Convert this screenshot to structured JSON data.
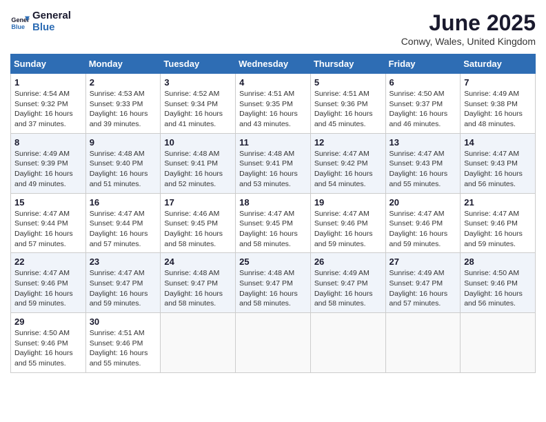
{
  "logo": {
    "line1": "General",
    "line2": "Blue"
  },
  "title": "June 2025",
  "location": "Conwy, Wales, United Kingdom",
  "days_of_week": [
    "Sunday",
    "Monday",
    "Tuesday",
    "Wednesday",
    "Thursday",
    "Friday",
    "Saturday"
  ],
  "weeks": [
    [
      {
        "day": "1",
        "sunrise": "Sunrise: 4:54 AM",
        "sunset": "Sunset: 9:32 PM",
        "daylight": "Daylight: 16 hours and 37 minutes."
      },
      {
        "day": "2",
        "sunrise": "Sunrise: 4:53 AM",
        "sunset": "Sunset: 9:33 PM",
        "daylight": "Daylight: 16 hours and 39 minutes."
      },
      {
        "day": "3",
        "sunrise": "Sunrise: 4:52 AM",
        "sunset": "Sunset: 9:34 PM",
        "daylight": "Daylight: 16 hours and 41 minutes."
      },
      {
        "day": "4",
        "sunrise": "Sunrise: 4:51 AM",
        "sunset": "Sunset: 9:35 PM",
        "daylight": "Daylight: 16 hours and 43 minutes."
      },
      {
        "day": "5",
        "sunrise": "Sunrise: 4:51 AM",
        "sunset": "Sunset: 9:36 PM",
        "daylight": "Daylight: 16 hours and 45 minutes."
      },
      {
        "day": "6",
        "sunrise": "Sunrise: 4:50 AM",
        "sunset": "Sunset: 9:37 PM",
        "daylight": "Daylight: 16 hours and 46 minutes."
      },
      {
        "day": "7",
        "sunrise": "Sunrise: 4:49 AM",
        "sunset": "Sunset: 9:38 PM",
        "daylight": "Daylight: 16 hours and 48 minutes."
      }
    ],
    [
      {
        "day": "8",
        "sunrise": "Sunrise: 4:49 AM",
        "sunset": "Sunset: 9:39 PM",
        "daylight": "Daylight: 16 hours and 49 minutes."
      },
      {
        "day": "9",
        "sunrise": "Sunrise: 4:48 AM",
        "sunset": "Sunset: 9:40 PM",
        "daylight": "Daylight: 16 hours and 51 minutes."
      },
      {
        "day": "10",
        "sunrise": "Sunrise: 4:48 AM",
        "sunset": "Sunset: 9:41 PM",
        "daylight": "Daylight: 16 hours and 52 minutes."
      },
      {
        "day": "11",
        "sunrise": "Sunrise: 4:48 AM",
        "sunset": "Sunset: 9:41 PM",
        "daylight": "Daylight: 16 hours and 53 minutes."
      },
      {
        "day": "12",
        "sunrise": "Sunrise: 4:47 AM",
        "sunset": "Sunset: 9:42 PM",
        "daylight": "Daylight: 16 hours and 54 minutes."
      },
      {
        "day": "13",
        "sunrise": "Sunrise: 4:47 AM",
        "sunset": "Sunset: 9:43 PM",
        "daylight": "Daylight: 16 hours and 55 minutes."
      },
      {
        "day": "14",
        "sunrise": "Sunrise: 4:47 AM",
        "sunset": "Sunset: 9:43 PM",
        "daylight": "Daylight: 16 hours and 56 minutes."
      }
    ],
    [
      {
        "day": "15",
        "sunrise": "Sunrise: 4:47 AM",
        "sunset": "Sunset: 9:44 PM",
        "daylight": "Daylight: 16 hours and 57 minutes."
      },
      {
        "day": "16",
        "sunrise": "Sunrise: 4:47 AM",
        "sunset": "Sunset: 9:44 PM",
        "daylight": "Daylight: 16 hours and 57 minutes."
      },
      {
        "day": "17",
        "sunrise": "Sunrise: 4:46 AM",
        "sunset": "Sunset: 9:45 PM",
        "daylight": "Daylight: 16 hours and 58 minutes."
      },
      {
        "day": "18",
        "sunrise": "Sunrise: 4:47 AM",
        "sunset": "Sunset: 9:45 PM",
        "daylight": "Daylight: 16 hours and 58 minutes."
      },
      {
        "day": "19",
        "sunrise": "Sunrise: 4:47 AM",
        "sunset": "Sunset: 9:46 PM",
        "daylight": "Daylight: 16 hours and 59 minutes."
      },
      {
        "day": "20",
        "sunrise": "Sunrise: 4:47 AM",
        "sunset": "Sunset: 9:46 PM",
        "daylight": "Daylight: 16 hours and 59 minutes."
      },
      {
        "day": "21",
        "sunrise": "Sunrise: 4:47 AM",
        "sunset": "Sunset: 9:46 PM",
        "daylight": "Daylight: 16 hours and 59 minutes."
      }
    ],
    [
      {
        "day": "22",
        "sunrise": "Sunrise: 4:47 AM",
        "sunset": "Sunset: 9:46 PM",
        "daylight": "Daylight: 16 hours and 59 minutes."
      },
      {
        "day": "23",
        "sunrise": "Sunrise: 4:47 AM",
        "sunset": "Sunset: 9:47 PM",
        "daylight": "Daylight: 16 hours and 59 minutes."
      },
      {
        "day": "24",
        "sunrise": "Sunrise: 4:48 AM",
        "sunset": "Sunset: 9:47 PM",
        "daylight": "Daylight: 16 hours and 58 minutes."
      },
      {
        "day": "25",
        "sunrise": "Sunrise: 4:48 AM",
        "sunset": "Sunset: 9:47 PM",
        "daylight": "Daylight: 16 hours and 58 minutes."
      },
      {
        "day": "26",
        "sunrise": "Sunrise: 4:49 AM",
        "sunset": "Sunset: 9:47 PM",
        "daylight": "Daylight: 16 hours and 58 minutes."
      },
      {
        "day": "27",
        "sunrise": "Sunrise: 4:49 AM",
        "sunset": "Sunset: 9:47 PM",
        "daylight": "Daylight: 16 hours and 57 minutes."
      },
      {
        "day": "28",
        "sunrise": "Sunrise: 4:50 AM",
        "sunset": "Sunset: 9:46 PM",
        "daylight": "Daylight: 16 hours and 56 minutes."
      }
    ],
    [
      {
        "day": "29",
        "sunrise": "Sunrise: 4:50 AM",
        "sunset": "Sunset: 9:46 PM",
        "daylight": "Daylight: 16 hours and 55 minutes."
      },
      {
        "day": "30",
        "sunrise": "Sunrise: 4:51 AM",
        "sunset": "Sunset: 9:46 PM",
        "daylight": "Daylight: 16 hours and 55 minutes."
      },
      null,
      null,
      null,
      null,
      null
    ]
  ]
}
